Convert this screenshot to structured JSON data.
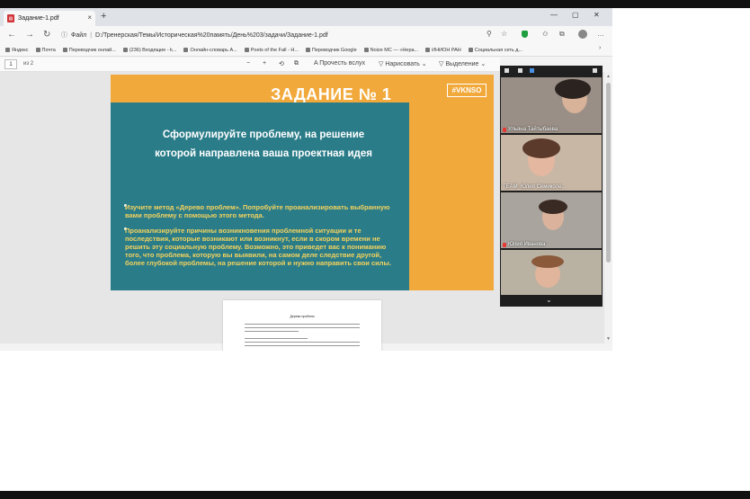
{
  "browser": {
    "tab_title": "Задание-1.pdf",
    "tab_close": "×",
    "new_tab": "+",
    "window_controls": [
      "—",
      "▢",
      "✕"
    ],
    "address_label": "Файл",
    "address_path": "D:/Тренерская/Темы/Историческая%20память/День%203/задачи/Задание-1.pdf",
    "bookmarks": [
      "Яндекс",
      "Почта",
      "Переводчик онлай...",
      "(236) Входящие - k...",
      "Онлайн-словарь А...",
      "Poets of the Fall - H...",
      "Переводчик Google",
      "Noize MC — «Нера...",
      "ИНИОН РАН",
      "Социальная сеть д..."
    ]
  },
  "pdf_toolbar": {
    "page_current": "1",
    "page_of": "из 2",
    "zoom_out": "−",
    "zoom_in": "+",
    "read_aloud": "Прочесть вслух",
    "draw": "Нарисовать",
    "highlight": "Выделение"
  },
  "slide": {
    "title": "ЗАДАНИЕ № 1",
    "badge": "#VKNSO",
    "heading_line1": "Сформулируйте проблему, на решение",
    "heading_line2": "которой направлена ваша проектная идея",
    "bullet1": "Изучите метод «Дерево проблем». Попробуйте проанализировать выбранную вами проблему с помощью этого метода.",
    "bullet2": "Проанализируйте причины возникновения проблемной ситуации и те последствия, которые возникают или возникнут, если в скором времени не решить эту социальную проблему. Возможно, это приведет вас к пониманию того, что проблема, которую вы выявили, на самом деле следствие другой, более глубокой проблемы, на решение которой и нужно направить свои силы."
  },
  "page2": {
    "title": "Дерево проблем"
  },
  "video": {
    "participants": [
      {
        "name": "Ульяна Тайтыбаева"
      },
      {
        "name": "TEAM_Юлия Семиколе..."
      },
      {
        "name": "Юлия Иванова"
      },
      {
        "name": ""
      }
    ],
    "chevron": "⌄"
  }
}
